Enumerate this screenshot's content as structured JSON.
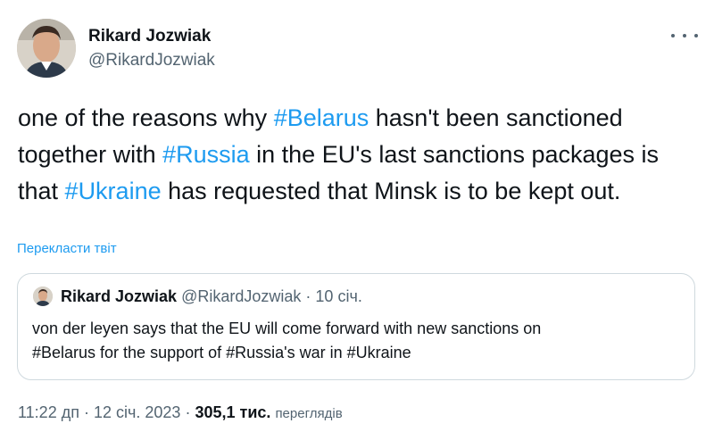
{
  "author": {
    "name": "Rikard Jozwiak",
    "handle": "@RikardJozwiak"
  },
  "tweet": {
    "segments": [
      {
        "text": "one of the reasons why ",
        "tag": false
      },
      {
        "text": "#Belarus",
        "tag": true
      },
      {
        "text": " hasn't been sanctioned together with ",
        "tag": false
      },
      {
        "text": "#Russia",
        "tag": true
      },
      {
        "text": " in the EU's last sanctions packages is that ",
        "tag": false
      },
      {
        "text": "#Ukraine",
        "tag": true
      },
      {
        "text": " has requested that Minsk is to be kept out.",
        "tag": false
      }
    ],
    "translate_label": "Перекласти твіт"
  },
  "quoted": {
    "name": "Rikard Jozwiak",
    "handle": "@RikardJozwiak",
    "separator": "·",
    "date": "10 січ.",
    "text_line1": "von der leyen says that the EU will come forward with new sanctions on",
    "text_line2": "#Belarus for the support of #Russia's war in #Ukraine"
  },
  "footer": {
    "time": "11:22 дп",
    "separator": "·",
    "date": "12 січ. 2023",
    "views_count": "305,1 тис.",
    "views_label": "переглядів"
  },
  "icons": {
    "more": "more-options-icon"
  },
  "colors": {
    "text": "#0f1419",
    "secondary": "#536471",
    "link": "#1d9bf0",
    "border": "#cfd9de"
  }
}
